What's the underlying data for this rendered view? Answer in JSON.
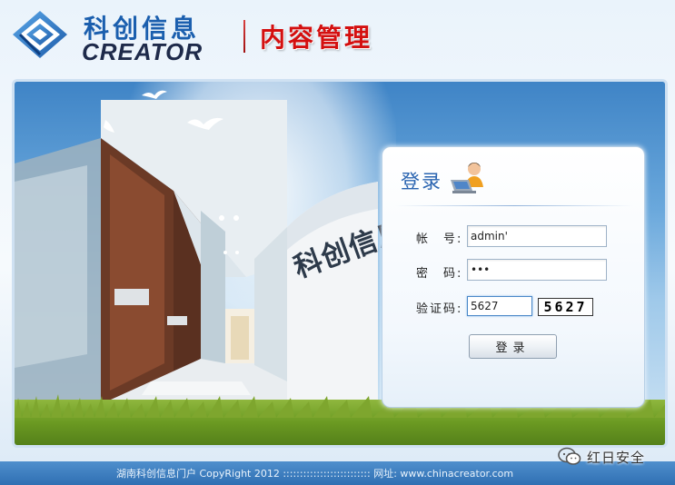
{
  "header": {
    "logo_cn": "科创信息",
    "logo_en": "CREATOR",
    "system_title": "内容管理"
  },
  "banner": {
    "building_sign": "科创信息"
  },
  "login": {
    "title": "登录",
    "username_label": "帐　号:",
    "username_value": "admin'",
    "password_label": "密　码:",
    "password_value": "•••",
    "captcha_label": "验证码:",
    "captcha_value": "5627",
    "captcha_image_text": "5627",
    "submit_label": "登录"
  },
  "footer": {
    "text": "湖南科创信息门户 CopyRight 2012 :::::::::::::::::::::::::: 网址: www.chinacreator.com"
  },
  "watermark": {
    "text": "红日安全",
    "icon": "wechat-icon"
  },
  "colors": {
    "brand_blue": "#1b5fae",
    "title_red": "#d40f0f",
    "footer_blue": "#2f6fb2"
  }
}
